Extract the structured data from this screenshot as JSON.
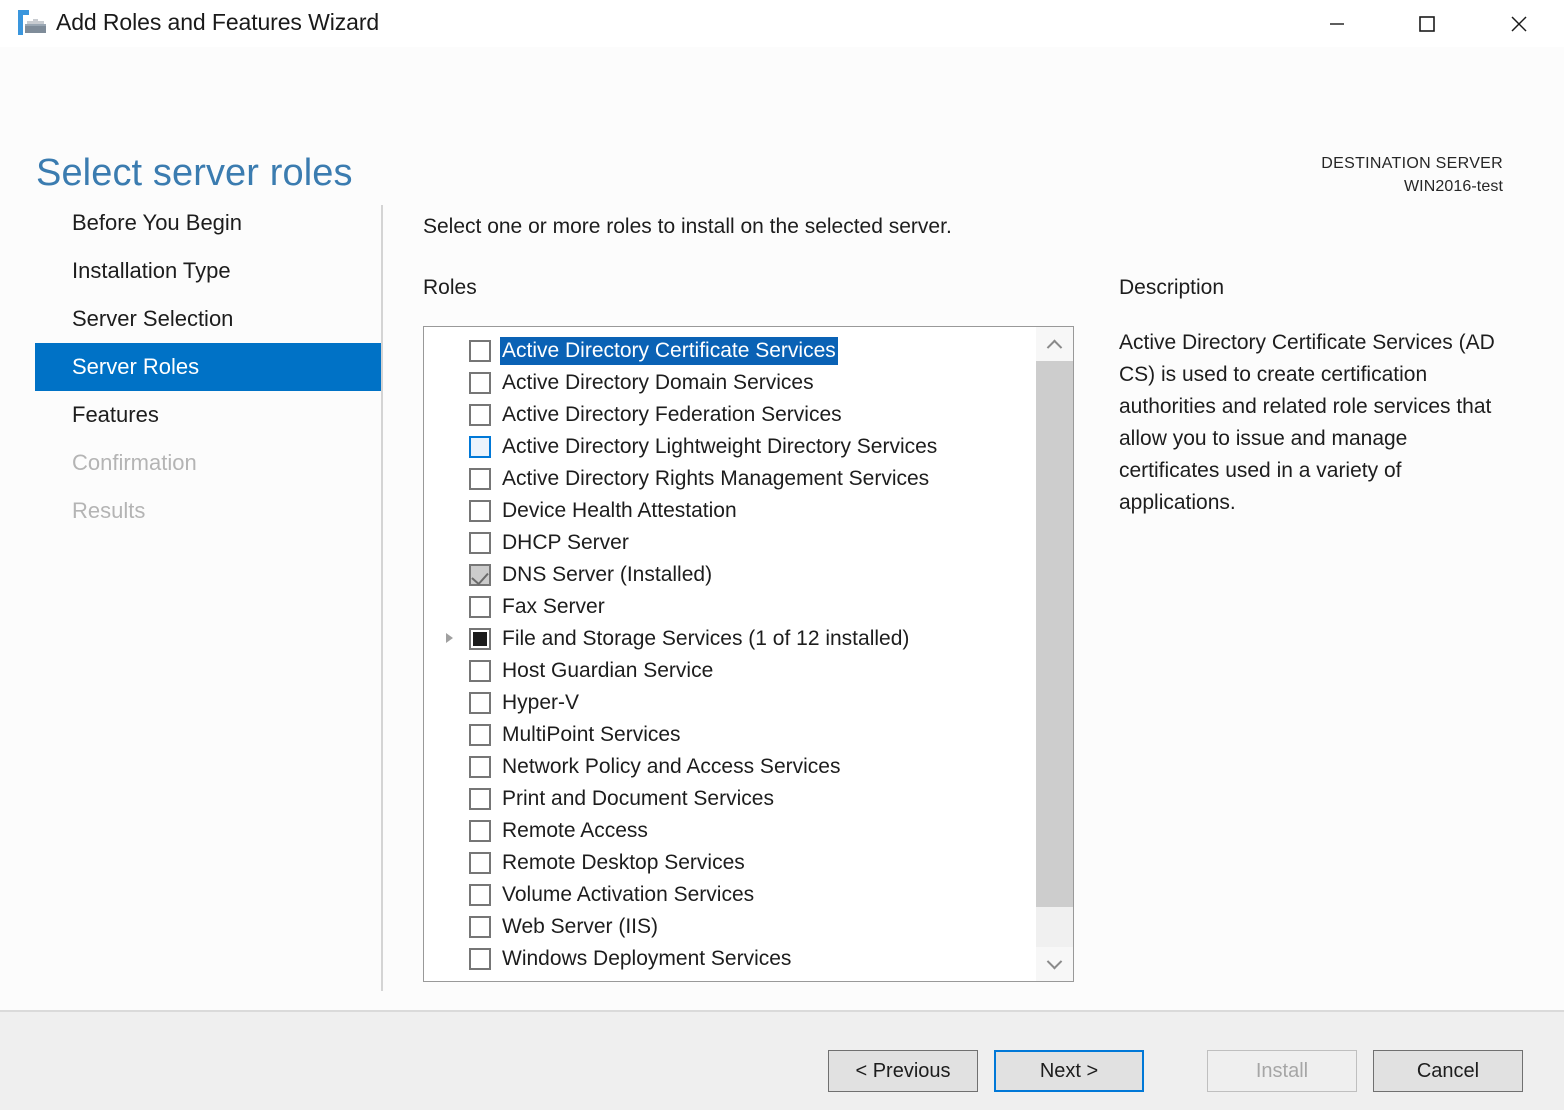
{
  "window": {
    "title": "Add Roles and Features Wizard",
    "icon": "wizard-toolbox-icon",
    "controls": {
      "minimize": "—",
      "maximize": "□",
      "close": "✕"
    }
  },
  "header": {
    "page_title": "Select server roles",
    "destination_label": "DESTINATION SERVER",
    "destination_server": "WIN2016-test",
    "accent_color": "#3b7cb0"
  },
  "sidebar": {
    "items": [
      {
        "label": "Before You Begin",
        "state": "normal"
      },
      {
        "label": "Installation Type",
        "state": "normal"
      },
      {
        "label": "Server Selection",
        "state": "normal"
      },
      {
        "label": "Server Roles",
        "state": "selected"
      },
      {
        "label": "Features",
        "state": "normal"
      },
      {
        "label": "Confirmation",
        "state": "disabled"
      },
      {
        "label": "Results",
        "state": "disabled"
      }
    ],
    "selected_color": "#0072c6"
  },
  "main": {
    "instruction": "Select one or more roles to install on the selected server.",
    "roles_label": "Roles",
    "selection_color": "#0a62b5",
    "roles": [
      {
        "label": "Active Directory Certificate Services",
        "checkbox": "unchecked",
        "selected": true,
        "expandable": false
      },
      {
        "label": "Active Directory Domain Services",
        "checkbox": "unchecked",
        "selected": false,
        "expandable": false
      },
      {
        "label": "Active Directory Federation Services",
        "checkbox": "unchecked",
        "selected": false,
        "expandable": false
      },
      {
        "label": "Active Directory Lightweight Directory Services",
        "checkbox": "hover",
        "selected": false,
        "expandable": false
      },
      {
        "label": "Active Directory Rights Management Services",
        "checkbox": "unchecked",
        "selected": false,
        "expandable": false
      },
      {
        "label": "Device Health Attestation",
        "checkbox": "unchecked",
        "selected": false,
        "expandable": false
      },
      {
        "label": "DHCP Server",
        "checkbox": "unchecked",
        "selected": false,
        "expandable": false
      },
      {
        "label": "DNS Server (Installed)",
        "checkbox": "installed",
        "selected": false,
        "expandable": false
      },
      {
        "label": "Fax Server",
        "checkbox": "unchecked",
        "selected": false,
        "expandable": false
      },
      {
        "label": "File and Storage Services (1 of 12 installed)",
        "checkbox": "partial",
        "selected": false,
        "expandable": true
      },
      {
        "label": "Host Guardian Service",
        "checkbox": "unchecked",
        "selected": false,
        "expandable": false
      },
      {
        "label": "Hyper-V",
        "checkbox": "unchecked",
        "selected": false,
        "expandable": false
      },
      {
        "label": "MultiPoint Services",
        "checkbox": "unchecked",
        "selected": false,
        "expandable": false
      },
      {
        "label": "Network Policy and Access Services",
        "checkbox": "unchecked",
        "selected": false,
        "expandable": false
      },
      {
        "label": "Print and Document Services",
        "checkbox": "unchecked",
        "selected": false,
        "expandable": false
      },
      {
        "label": "Remote Access",
        "checkbox": "unchecked",
        "selected": false,
        "expandable": false
      },
      {
        "label": "Remote Desktop Services",
        "checkbox": "unchecked",
        "selected": false,
        "expandable": false
      },
      {
        "label": "Volume Activation Services",
        "checkbox": "unchecked",
        "selected": false,
        "expandable": false
      },
      {
        "label": "Web Server (IIS)",
        "checkbox": "unchecked",
        "selected": false,
        "expandable": false
      },
      {
        "label": "Windows Deployment Services",
        "checkbox": "unchecked",
        "selected": false,
        "expandable": false
      }
    ]
  },
  "description": {
    "title": "Description",
    "text": "Active Directory Certificate Services (AD CS) is used to create certification authorities and related role services that allow you to issue and manage certificates used in a variety of applications."
  },
  "footer": {
    "previous_label": "< Previous",
    "next_label": "Next >",
    "install_label": "Install",
    "cancel_label": "Cancel",
    "install_enabled": false,
    "focus_color": "#0078d7"
  }
}
